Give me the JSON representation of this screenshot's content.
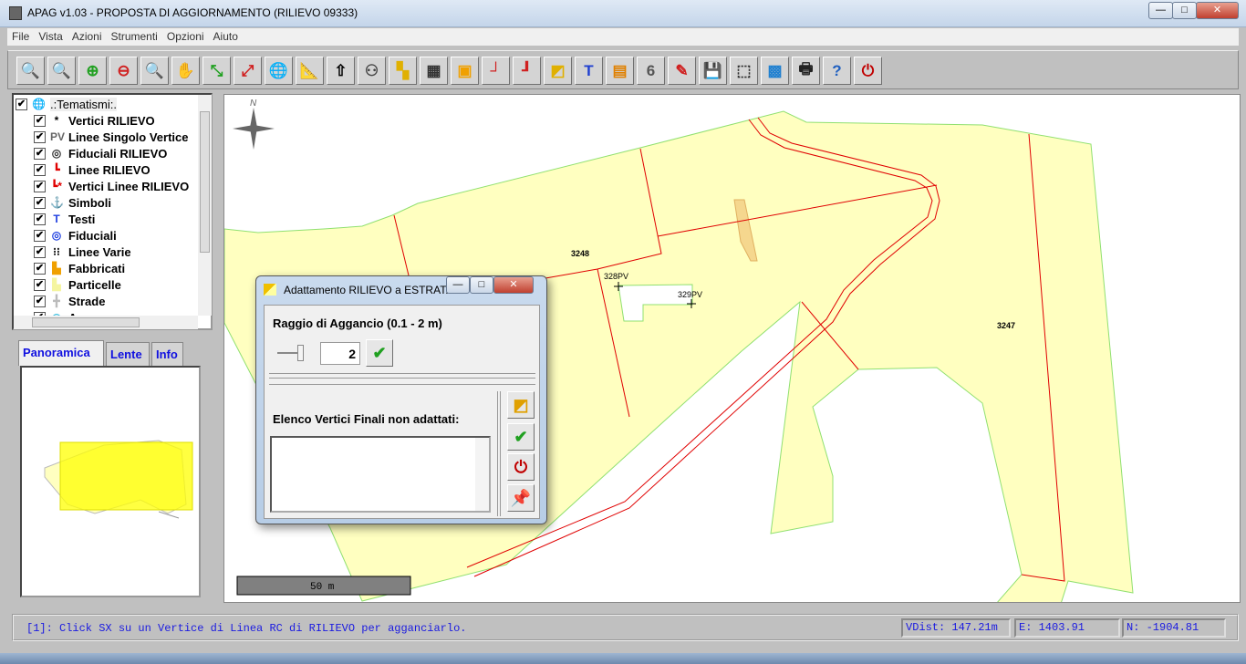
{
  "window": {
    "title": "APAG v1.03 - PROPOSTA DI AGGIORNAMENTO (RILIEVO 09333)",
    "minimize": "—",
    "maximize": "□",
    "close": "✕"
  },
  "menu": [
    "File",
    "Vista",
    "Azioni",
    "Strumenti",
    "Opzioni",
    "Aiuto"
  ],
  "toolbar": [
    {
      "name": "zoom-previous",
      "glyph": "🔍",
      "color": "#e04010"
    },
    {
      "name": "zoom-next",
      "glyph": "🔍",
      "color": "#20a020"
    },
    {
      "name": "zoom-in",
      "glyph": "⊕",
      "color": "#20a020"
    },
    {
      "name": "zoom-out",
      "glyph": "⊖",
      "color": "#d02020"
    },
    {
      "name": "zoom-window",
      "glyph": "🔍",
      "color": "#3070c0"
    },
    {
      "name": "pan-hand",
      "glyph": "✋",
      "color": "#b07040"
    },
    {
      "name": "zoom-extents",
      "glyph": "⤡",
      "color": "#20a020"
    },
    {
      "name": "zoom-expand",
      "glyph": "⤢",
      "color": "#d02020"
    },
    {
      "name": "globe",
      "glyph": "🌐",
      "color": "#2080d0"
    },
    {
      "name": "ruler",
      "glyph": "📐",
      "color": "#b09020"
    },
    {
      "name": "label-select",
      "glyph": "⇧",
      "color": "#000"
    },
    {
      "name": "binoculars",
      "glyph": "⚇",
      "color": "#444"
    },
    {
      "name": "find-parcel",
      "glyph": "▚",
      "color": "#e0b000"
    },
    {
      "name": "table",
      "glyph": "▦",
      "color": "#333"
    },
    {
      "name": "layers",
      "glyph": "▣",
      "color": "#f0a000"
    },
    {
      "name": "find-line",
      "glyph": "┘",
      "color": "#d02020"
    },
    {
      "name": "edit-line",
      "glyph": "┚",
      "color": "#d02020"
    },
    {
      "name": "adapt",
      "glyph": "◩",
      "color": "#e0b000"
    },
    {
      "name": "edit-text",
      "glyph": "T",
      "color": "#2040d0"
    },
    {
      "name": "grid-edit",
      "glyph": "▤",
      "color": "#e08000"
    },
    {
      "name": "number",
      "glyph": "6",
      "color": "#555"
    },
    {
      "name": "pencil-edit",
      "glyph": "✎",
      "color": "#d02020"
    },
    {
      "name": "save",
      "glyph": "💾",
      "color": "#1060c0"
    },
    {
      "name": "frame",
      "glyph": "⬚",
      "color": "#333"
    },
    {
      "name": "export",
      "glyph": "▩",
      "color": "#2080d0"
    },
    {
      "name": "print",
      "glyph": "🖶",
      "color": "#222"
    },
    {
      "name": "help",
      "glyph": "?",
      "color": "#2060c0"
    },
    {
      "name": "power",
      "glyph": "⏻",
      "color": "#c00000"
    }
  ],
  "tree": {
    "root": ".:Tematismi:.",
    "items": [
      {
        "label": "Vertici RILIEVO",
        "icon": "*",
        "color": "#000"
      },
      {
        "label": "Linee Singolo Vertice",
        "icon": "PV",
        "color": "#666"
      },
      {
        "label": "Fiduciali RILIEVO",
        "icon": "◎",
        "color": "#333"
      },
      {
        "label": "Linee RILIEVO",
        "icon": "┗",
        "color": "#e00000"
      },
      {
        "label": "Vertici Linee RILIEVO",
        "icon": "┗*",
        "color": "#e00000"
      },
      {
        "label": "Simboli",
        "icon": "⚓",
        "color": "#2040e0"
      },
      {
        "label": "Testi",
        "icon": "T",
        "color": "#2040e0"
      },
      {
        "label": "Fiduciali",
        "icon": "◎",
        "color": "#2040e0"
      },
      {
        "label": "Linee Varie",
        "icon": "⁝⁝",
        "color": "#000"
      },
      {
        "label": "Fabbricati",
        "icon": "▙",
        "color": "#f0a000"
      },
      {
        "label": "Particelle",
        "icon": "▙",
        "color": "#f5f5a0"
      },
      {
        "label": "Strade",
        "icon": "╋",
        "color": "#bbb"
      },
      {
        "label": "Acque",
        "icon": "◠",
        "color": "#40c0e0"
      }
    ]
  },
  "tabs": [
    "Panoramica",
    "Lente",
    "Info"
  ],
  "map": {
    "north": "N",
    "parcels": [
      "3248",
      "3247"
    ],
    "points": [
      "328PV",
      "329PV"
    ],
    "scale": "50 m",
    "colors": {
      "parcel": "#ffffc0",
      "parcel_edge": "#90e070",
      "line": "#e00000",
      "building": "#f5d78e"
    }
  },
  "dialog": {
    "title": "Adattamento RILIEVO a ESTRAT...",
    "radius_label": "Raggio di Aggancio (0.1 - 2 m)",
    "radius_value": "2",
    "list_label": "Elenco Vertici Finali non adattati:"
  },
  "status": {
    "message": "[1]: Click SX su un Vertice di Linea RC di RILIEVO per agganciarlo.",
    "vdist": "VDist: 147.21m",
    "e": "E: 1403.91",
    "n": "N: -1904.81"
  }
}
